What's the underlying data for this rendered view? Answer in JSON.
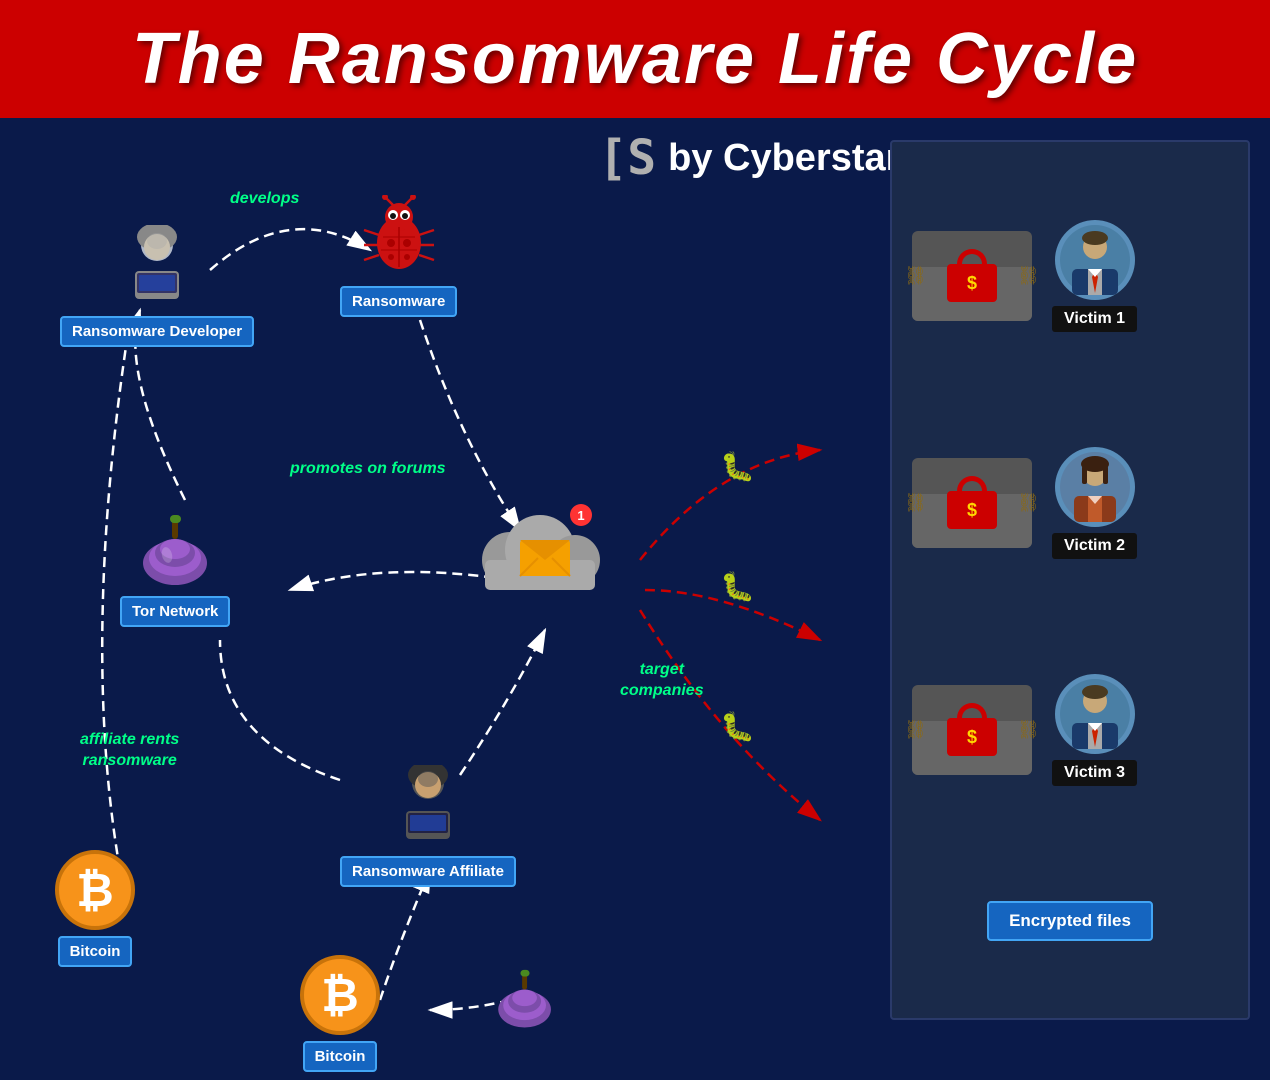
{
  "header": {
    "title": "The Ransomware Life Cycle"
  },
  "brand": {
    "bracket": "[S",
    "name": "by Cyberstanc"
  },
  "nodes": {
    "developer": {
      "label": "Ransomware Developer",
      "icon": "🧑‍💻"
    },
    "ransomware": {
      "label": "Ransomware",
      "icon": "🐛"
    },
    "tor": {
      "label": "Tor Network",
      "icon": "🧅"
    },
    "cloud": {
      "label": ""
    },
    "affiliate": {
      "label": "Ransomware Affiliate",
      "icon": "🧑‍💻"
    },
    "bitcoin_left": {
      "label": "Bitcoin"
    },
    "bitcoin_bottom": {
      "label": "Bitcoin"
    }
  },
  "arrow_labels": {
    "develops": "develops",
    "promotes": "promotes on forums",
    "affiliate_rents": "affiliate rents\nransomware",
    "target": "target\ncompanies"
  },
  "victims": [
    {
      "label": "Victim 1",
      "gender": "male"
    },
    {
      "label": "Victim 2",
      "gender": "female"
    },
    {
      "label": "Victim 3",
      "gender": "male"
    }
  ],
  "panel_footer": "Encrypted files",
  "colors": {
    "background": "#0a1a4a",
    "header": "#cc0000",
    "node_label_bg": "#1565c0",
    "green_text": "#00ff88",
    "bitcoin_orange": "#f7931a"
  }
}
